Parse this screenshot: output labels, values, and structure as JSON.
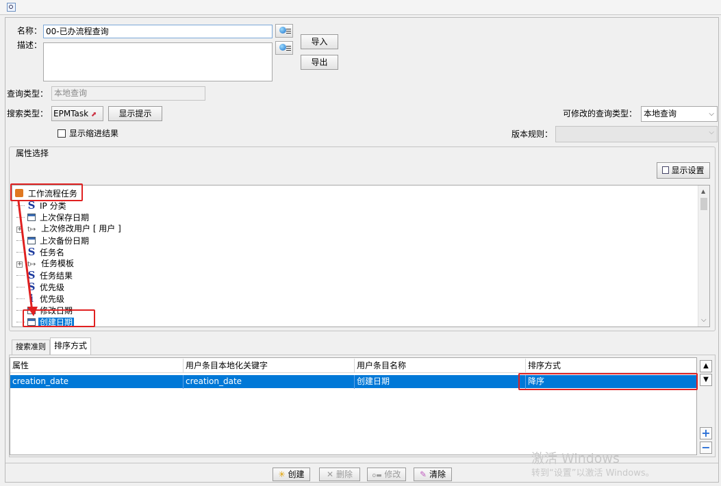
{
  "window": {
    "toolbar_icon": "query-icon"
  },
  "form": {
    "name_label": "名称：",
    "name_value": "00-已办流程查询",
    "desc_label": "描述：",
    "desc_value": "",
    "import_label": "导入",
    "export_label": "导出",
    "query_type_label": "查询类型：",
    "query_type_value": "本地查询",
    "search_type_label": "搜索类型：",
    "search_type_value": "EPMTask",
    "show_hint_label": "显示提示",
    "modifiable_type_label": "可修改的查询类型：",
    "modifiable_type_value": "本地查询",
    "indent_checkbox_label": "显示缩进结果",
    "indent_checked": false,
    "revision_rule_label": "版本规则：",
    "revision_rule_value": ""
  },
  "attributes": {
    "group_label": "属性选择",
    "display_settings_label": "显示设置",
    "root_label": "工作流程任务",
    "items": [
      {
        "icon": "string-icon",
        "label": "IP 分类",
        "expandable": false
      },
      {
        "icon": "date-icon",
        "label": "上次保存日期",
        "expandable": false
      },
      {
        "icon": "reference-icon",
        "label": "上次修改用户 [ 用户 ]",
        "expandable": true
      },
      {
        "icon": "date-icon",
        "label": "上次备份日期",
        "expandable": false
      },
      {
        "icon": "string-icon",
        "label": "任务名",
        "expandable": false
      },
      {
        "icon": "reference-icon",
        "label": "任务模板",
        "expandable": true
      },
      {
        "icon": "string-icon",
        "label": "任务结果",
        "expandable": false
      },
      {
        "icon": "string-icon",
        "label": "优先级",
        "expandable": false
      },
      {
        "icon": "integer-icon",
        "label": "优先级",
        "expandable": false
      },
      {
        "icon": "date-icon",
        "label": "修改日期",
        "expandable": false
      },
      {
        "icon": "date-icon",
        "label": "创建日期",
        "expandable": false,
        "selected": true
      }
    ]
  },
  "tabs": [
    {
      "label": "搜索准则",
      "active": false
    },
    {
      "label": "排序方式",
      "active": true
    }
  ],
  "sort_table": {
    "headers": [
      "属性",
      "用户条目本地化关键字",
      "用户条目名称",
      "排序方式"
    ],
    "rows": [
      [
        "creation_date",
        "creation_date",
        "创建日期",
        "降序"
      ]
    ]
  },
  "bottom_buttons": {
    "create": "创建",
    "delete": "删除",
    "modify": "修改",
    "clear": "清除"
  },
  "watermark": {
    "line1": "激活 Windows",
    "line2": "转到“设置”以激活 Windows。"
  },
  "colors": {
    "selection": "#0078d7",
    "annotation_red": "#e02020"
  }
}
